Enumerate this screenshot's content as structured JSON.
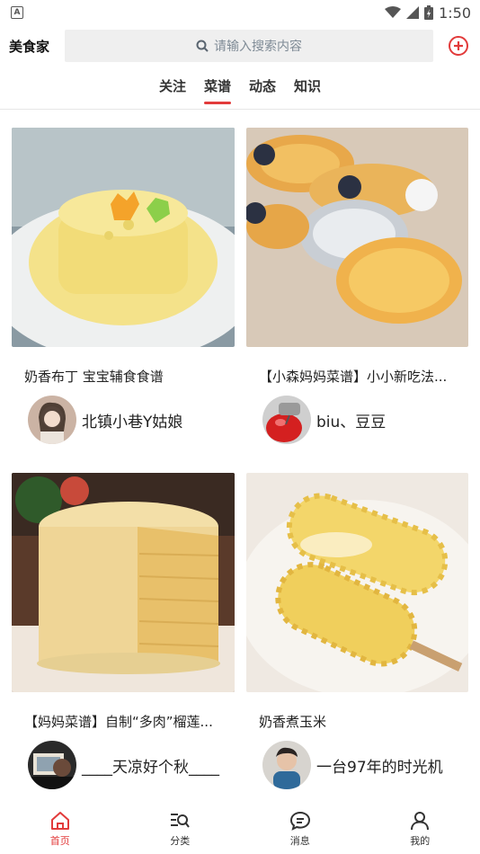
{
  "status_bar": {
    "time": "1:50",
    "left_badge": "A"
  },
  "header": {
    "app_title": "美食家",
    "search_placeholder": "请输入搜索内容"
  },
  "tabs": [
    {
      "label": "关注",
      "active": false
    },
    {
      "label": "菜谱",
      "active": true
    },
    {
      "label": "动态",
      "active": false
    },
    {
      "label": "知识",
      "active": false
    }
  ],
  "cards": [
    {
      "caption": "奶香布丁 宝宝辅食食谱",
      "author": "北镇小巷Y姑娘"
    },
    {
      "caption": "【小森妈妈菜谱】小小新吃法...",
      "author": "biu、豆豆"
    },
    {
      "caption": "【妈妈菜谱】自制“多肉”榴莲...",
      "author": "____天凉好个秋____"
    },
    {
      "caption": "奶香煮玉米",
      "author": "一台97年的时光机"
    }
  ],
  "bottom_nav": [
    {
      "label": "首页",
      "icon": "home-icon",
      "active": true
    },
    {
      "label": "分类",
      "icon": "category-search-icon",
      "active": false
    },
    {
      "label": "消息",
      "icon": "message-icon",
      "active": false
    },
    {
      "label": "我的",
      "icon": "profile-icon",
      "active": false
    }
  ],
  "colors": {
    "accent": "#e23b3b",
    "search_bg": "#efefef"
  }
}
